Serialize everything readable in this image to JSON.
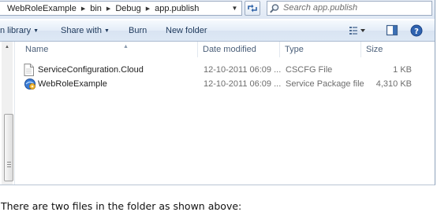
{
  "address": {
    "crumbs": [
      "WebRoleExample",
      "bin",
      "Debug",
      "app.publish"
    ],
    "search_placeholder": "Search app.publish"
  },
  "toolbar": {
    "include_library": "n library",
    "share_with": "Share with",
    "burn": "Burn",
    "new_folder": "New folder"
  },
  "columns": {
    "name": "Name",
    "date": "Date modified",
    "type": "Type",
    "size": "Size"
  },
  "files": [
    {
      "name": "ServiceConfiguration.Cloud",
      "date": "12-10-2011 06:09 ...",
      "type": "CSCFG File",
      "size": "1 KB",
      "icon": "document-icon"
    },
    {
      "name": "WebRoleExample",
      "date": "12-10-2011 06:09 ...",
      "type": "Service Package file",
      "size": "4,310 KB",
      "icon": "service-package-icon"
    }
  ],
  "caption": "There are two files in the folder as shown above:",
  "colors": {
    "accent": "#1e395b",
    "window_border": "#8da2bb"
  }
}
